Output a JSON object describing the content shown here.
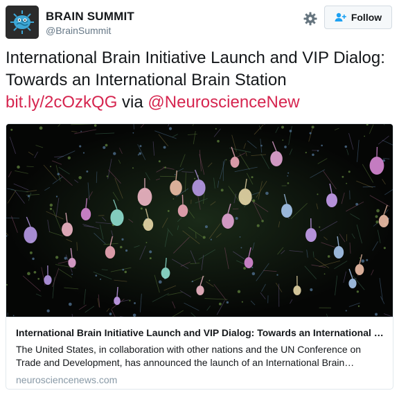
{
  "account": {
    "name": "BRAIN SUMMIT",
    "handle": "@BrainSummit"
  },
  "actions": {
    "follow_label": "Follow",
    "settings_icon": "gear-icon",
    "follow_icon": "add-user-icon"
  },
  "tweet": {
    "text": "International Brain Initiative Launch and VIP Dialog: Towards an International Brain Station",
    "link": "bit.ly/2cOzkQG",
    "via_word": "via",
    "mention": "@NeuroscienceNew"
  },
  "card": {
    "title": "International Brain Initiative Launch and VIP Dialog: Towards an International Brain Station",
    "description": "The United States, in collaboration with other nations and the UN Conference on Trade and Development, has announced the launch of an International Brain Initiative.",
    "domain": "neurosciencenews.com"
  },
  "colors": {
    "link": "#d6254f",
    "muted": "#657786",
    "border": "#e1e8ed"
  }
}
